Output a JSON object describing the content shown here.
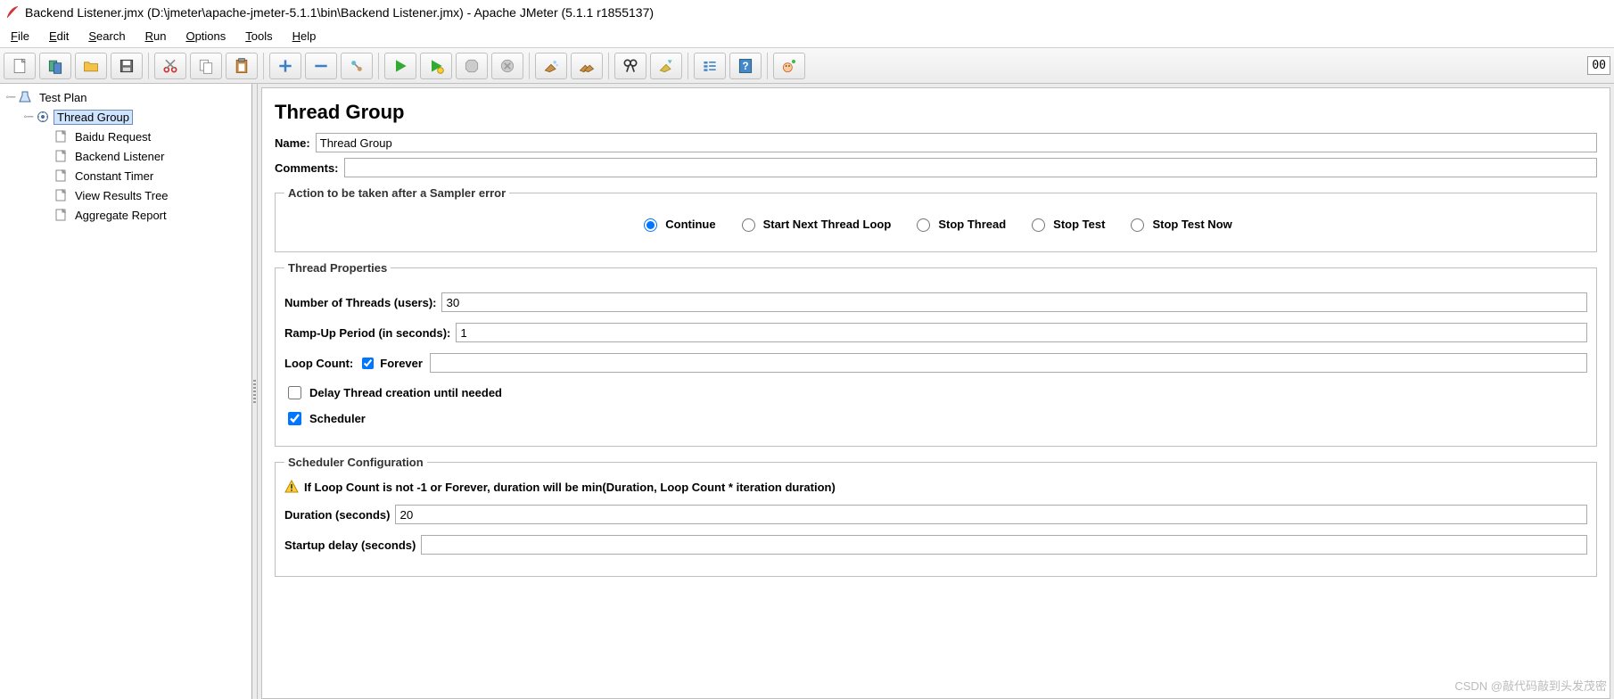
{
  "window": {
    "title": "Backend Listener.jmx (D:\\jmeter\\apache-jmeter-5.1.1\\bin\\Backend Listener.jmx) - Apache JMeter (5.1.1 r1855137)"
  },
  "menu": {
    "file": "File",
    "edit": "Edit",
    "search": "Search",
    "run": "Run",
    "options": "Options",
    "tools": "Tools",
    "help": "Help"
  },
  "toolbar": {
    "elapsed": "00"
  },
  "tree": {
    "root": {
      "label": "Test Plan"
    },
    "thread_group": {
      "label": "Thread Group"
    },
    "children": [
      {
        "label": "Baidu Request"
      },
      {
        "label": "Backend Listener"
      },
      {
        "label": "Constant Timer"
      },
      {
        "label": "View Results Tree"
      },
      {
        "label": "Aggregate Report"
      }
    ]
  },
  "panel": {
    "title": "Thread Group",
    "name_label": "Name:",
    "name_value": "Thread Group",
    "comments_label": "Comments:",
    "comments_value": "",
    "error_legend": "Action to be taken after a Sampler error",
    "error_options": {
      "continue": "Continue",
      "start_next": "Start Next Thread Loop",
      "stop_thread": "Stop Thread",
      "stop_test": "Stop Test",
      "stop_test_now": "Stop Test Now"
    },
    "thread_props_legend": "Thread Properties",
    "num_threads_label": "Number of Threads (users):",
    "num_threads_value": "30",
    "ramp_up_label": "Ramp-Up Period (in seconds):",
    "ramp_up_value": "1",
    "loop_count_label": "Loop Count:",
    "forever_label": "Forever",
    "loop_count_value": "",
    "delay_thread_label": "Delay Thread creation until needed",
    "scheduler_label": "Scheduler",
    "sched_legend": "Scheduler Configuration",
    "sched_warn": "If Loop Count is not -1 or Forever, duration will be min(Duration, Loop Count * iteration duration)",
    "duration_label": "Duration (seconds)",
    "duration_value": "20",
    "startup_delay_label": "Startup delay (seconds)",
    "startup_delay_value": ""
  },
  "watermark": "CSDN @敲代码敲到头发茂密"
}
